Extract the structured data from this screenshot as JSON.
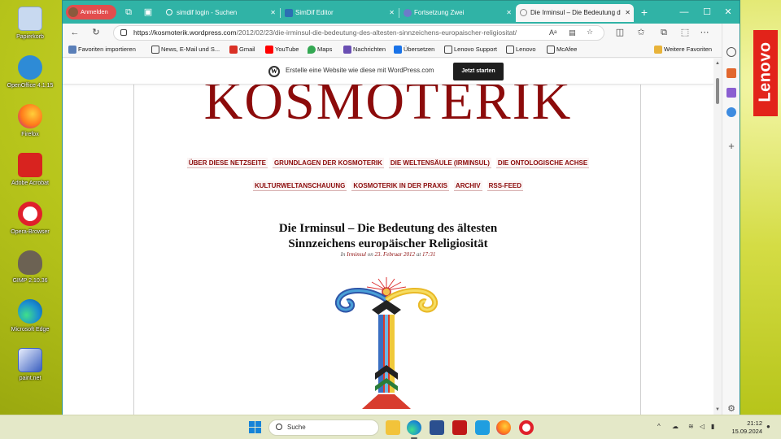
{
  "desktop": {
    "icons": [
      {
        "label": "Papierkorb",
        "icon": "recycle-bin-icon",
        "color": "#c8d9f0"
      },
      {
        "label": "OpenOffice 4.1.15",
        "icon": "openoffice-icon",
        "color": "#2e8bd6"
      },
      {
        "label": "Firefox",
        "icon": "firefox-icon",
        "color": "#ff7a1a"
      },
      {
        "label": "Adobe Acrobat",
        "icon": "acrobat-icon",
        "color": "#d8231f"
      },
      {
        "label": "Opera-Browser",
        "icon": "opera-icon",
        "color": "#e0202b"
      },
      {
        "label": "GIMP 2.10.36",
        "icon": "gimp-icon",
        "color": "#6c6253"
      },
      {
        "label": "Microsoft Edge",
        "icon": "edge-icon",
        "color": "#1b8ed1"
      },
      {
        "label": "paint.net",
        "icon": "paintnet-icon",
        "color": "#3a5fc0"
      }
    ],
    "brand_badge": "Lenovo"
  },
  "browser": {
    "profile_label": "Anmelden",
    "tabs": [
      {
        "title": "simdif login - Suchen",
        "icon": "search-icon",
        "fav_color": "#5b9bd5",
        "active": false
      },
      {
        "title": "SimDif Editor",
        "icon": "simdif-icon",
        "fav_color": "#2c6fb3",
        "active": false
      },
      {
        "title": "Fortsetzung Zwei",
        "icon": "globe-icon",
        "fav_color": "#6c7bc9",
        "active": false
      },
      {
        "title": "Die Irminsul – Die Bedeutung d",
        "icon": "wordpress-icon",
        "fav_color": "#888888",
        "active": true
      }
    ],
    "new_tab": "+",
    "address": {
      "url_host": "https://kosmoterik.wordpress.com",
      "url_path": "/2012/02/23/die-irminsul-die-bedeutung-des-altesten-sinnzeichens-europaischer-religiositat/"
    },
    "favorites": [
      {
        "label": "Favoriten importieren",
        "color": "#5a7fb8"
      },
      {
        "label": "News, E-Mail und S...",
        "color": "#444444"
      },
      {
        "label": "Gmail",
        "color": "#d93025"
      },
      {
        "label": "YouTube",
        "color": "#ff0000"
      },
      {
        "label": "Maps",
        "color": "#34a853"
      },
      {
        "label": "Nachrichten",
        "color": "#6a4fb3"
      },
      {
        "label": "Übersetzen",
        "color": "#1a73e8"
      },
      {
        "label": "Lenovo Support",
        "color": "#444444"
      },
      {
        "label": "Lenovo",
        "color": "#e2231a"
      },
      {
        "label": "McAfee",
        "color": "#c01818"
      },
      {
        "label": "Weitere Favoriten",
        "color": "#e8b33a"
      }
    ]
  },
  "wp_banner": {
    "text": "Erstelle eine Website wie diese mit WordPress.com",
    "button": "Jetzt starten"
  },
  "page": {
    "site_title": "KOSMOTERIK",
    "nav_row1": [
      "ÜBER DIESE NETZSEITE",
      "GRUNDLAGEN DER KOSMOTERIK",
      "DIE WELTENSÄULE (IRMINSUL)",
      "DIE ONTOLOGISCHE ACHSE"
    ],
    "nav_row2": [
      "KULTURWELTANSCHAUUNG",
      "KOSMOTERIK IN DER PRAXIS",
      "ARCHIV",
      "RSS-FEED"
    ],
    "post_title_line1": "Die Irminsul – Die Bedeutung des ältesten",
    "post_title_line2": "Sinnzeichens europäischer Religiosität",
    "meta_in": "In",
    "meta_category": "Irminsul",
    "meta_on": "on",
    "meta_date": "23. Februar 2012",
    "meta_at": "at",
    "meta_time": "17:31"
  },
  "taskbar": {
    "search_placeholder": "Suche",
    "clock_time": "21:12",
    "clock_date": "15.09.2024"
  }
}
